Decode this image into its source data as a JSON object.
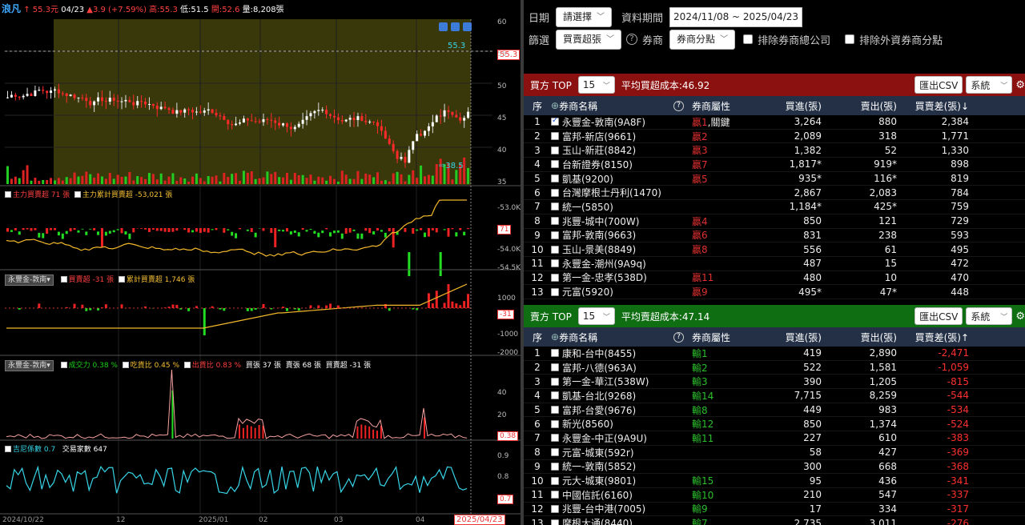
{
  "chart_header": {
    "name": "浪凡",
    "arrow": "↑",
    "price": "55.3元",
    "date": "04/23",
    "change": "▲3.9 (+7.59%)",
    "high": "高:55.3",
    "low": "低:51.5",
    "open": "開:52.6",
    "volume": "量:8,208張"
  },
  "price_axis": [
    "60",
    "55",
    "50",
    "45",
    "40",
    "35"
  ],
  "price_tags": {
    "last": "55.3",
    "high_mark": "55.3",
    "low_mark": "38.5"
  },
  "pane2": {
    "item1": "主力買賣超 71 張",
    "item2": "主力累計買賣超 -53,021 張",
    "axis": [
      "-53.0K",
      "-54.0K",
      "-54.5K"
    ],
    "tag": "71"
  },
  "pane3": {
    "select": "永豐金-敦南",
    "item1": "買賣超 -31 張",
    "item2": "累計買賣超 1,746 張",
    "axis": [
      "1000",
      "-1000",
      "-2000"
    ],
    "tag": "-31"
  },
  "pane4": {
    "select": "永豐金-敦南",
    "item1": "成交力 0.38 %",
    "item2": "吃貨比 0.45 %",
    "item3": "出貨比 0.83 %",
    "buy": "買張 37 張",
    "sell": "賣張 68 張",
    "net": "買賣超 -31 張",
    "axis": [
      "40",
      "20",
      "0"
    ],
    "tag": "0.38"
  },
  "pane5": {
    "item1": "吉尼係數 0.7",
    "item2": "交易家數 647",
    "axis": [
      "0.9",
      "0.8",
      "0.7"
    ],
    "tag": "0.7"
  },
  "x_axis": [
    "2024/10/22",
    "12",
    "2025/01",
    "02",
    "03",
    "04"
  ],
  "x_cursor": "2025/04/23",
  "filters": {
    "date_label": "日期",
    "date_select": "請選擇",
    "period_label": "資料期間",
    "period_value": "2024/11/08 ~ 2025/04/23",
    "filter_label": "篩選",
    "filter_select": "買賣超張",
    "broker_label": "券商",
    "broker_select": "券商分點",
    "excl1": "排除券商總公司",
    "excl2": "排除外資券商分點"
  },
  "buy_panel": {
    "title": "買方 TOP",
    "count": "15",
    "avg": "平均買超成本:46.92",
    "export": "匯出CSV",
    "system": "系統",
    "color": "#8b1010",
    "columns": [
      "序",
      "券商名稱",
      "券商屬性",
      "買進(張)",
      "賣出(張)",
      "買賣差(張)↓"
    ],
    "rows": [
      {
        "no": "1",
        "name": "永豐金-敦南(9A8F)",
        "attr": "贏1",
        "attr2": ",關鍵",
        "buy": "3,264",
        "sell": "880",
        "diff": "2,384",
        "checked": true
      },
      {
        "no": "2",
        "name": "富邦-新店(9661)",
        "attr": "贏2",
        "attr2": "",
        "buy": "2,089",
        "sell": "318",
        "diff": "1,771"
      },
      {
        "no": "3",
        "name": "玉山-新莊(8842)",
        "attr": "贏3",
        "attr2": "",
        "buy": "1,382",
        "sell": "52",
        "diff": "1,330"
      },
      {
        "no": "4",
        "name": "台新證券(8150)",
        "attr": "贏7",
        "attr2": "",
        "buy": "1,817*",
        "sell": "919*",
        "diff": "898"
      },
      {
        "no": "5",
        "name": "凱基(9200)",
        "attr": "贏5",
        "attr2": "",
        "buy": "935*",
        "sell": "116*",
        "diff": "819"
      },
      {
        "no": "6",
        "name": "台灣摩根士丹利(1470)",
        "attr": "",
        "attr2": "",
        "buy": "2,867",
        "sell": "2,083",
        "diff": "784"
      },
      {
        "no": "7",
        "name": "統一(5850)",
        "attr": "",
        "attr2": "",
        "buy": "1,184*",
        "sell": "425*",
        "diff": "759"
      },
      {
        "no": "8",
        "name": "兆豐-城中(700W)",
        "attr": "贏4",
        "attr2": "",
        "buy": "850",
        "sell": "121",
        "diff": "729"
      },
      {
        "no": "9",
        "name": "富邦-敦南(9663)",
        "attr": "贏6",
        "attr2": "",
        "buy": "831",
        "sell": "238",
        "diff": "593"
      },
      {
        "no": "10",
        "name": "玉山-景美(8849)",
        "attr": "贏8",
        "attr2": "",
        "buy": "556",
        "sell": "61",
        "diff": "495"
      },
      {
        "no": "11",
        "name": "永豐金-潮州(9A9q)",
        "attr": "",
        "attr2": "",
        "buy": "487",
        "sell": "15",
        "diff": "472"
      },
      {
        "no": "12",
        "name": "第一金-忠孝(538D)",
        "attr": "贏11",
        "attr2": "",
        "buy": "480",
        "sell": "10",
        "diff": "470"
      },
      {
        "no": "13",
        "name": "元富(5920)",
        "attr": "贏9",
        "attr2": "",
        "buy": "495*",
        "sell": "47*",
        "diff": "448"
      }
    ]
  },
  "sell_panel": {
    "title": "賣方 TOP",
    "count": "15",
    "avg": "平均賣超成本:47.14",
    "export": "匯出CSV",
    "system": "系統",
    "color": "#0f6d12",
    "columns": [
      "序",
      "券商名稱",
      "券商屬性",
      "買進(張)",
      "賣出(張)",
      "買賣差(張)↑"
    ],
    "rows": [
      {
        "no": "1",
        "name": "康和-台中(8455)",
        "attr": "輸1",
        "buy": "419",
        "sell": "2,890",
        "diff": "-2,471"
      },
      {
        "no": "2",
        "name": "富邦-八德(963A)",
        "attr": "輸2",
        "buy": "522",
        "sell": "1,581",
        "diff": "-1,059"
      },
      {
        "no": "3",
        "name": "第一金-華江(538W)",
        "attr": "輸3",
        "buy": "390",
        "sell": "1,205",
        "diff": "-815"
      },
      {
        "no": "4",
        "name": "凱基-台北(9268)",
        "attr": "輸14",
        "buy": "7,715",
        "sell": "8,259",
        "diff": "-544"
      },
      {
        "no": "5",
        "name": "富邦-台愛(9676)",
        "attr": "輸8",
        "buy": "449",
        "sell": "983",
        "diff": "-534"
      },
      {
        "no": "6",
        "name": "新光(8560)",
        "attr": "輸12",
        "buy": "850",
        "sell": "1,374",
        "diff": "-524"
      },
      {
        "no": "7",
        "name": "永豐金-中正(9A9U)",
        "attr": "輸11",
        "buy": "227",
        "sell": "610",
        "diff": "-383"
      },
      {
        "no": "8",
        "name": "元富-城東(592r)",
        "attr": "",
        "buy": "58",
        "sell": "427",
        "diff": "-369"
      },
      {
        "no": "9",
        "name": "統一-敦南(5852)",
        "attr": "",
        "buy": "300",
        "sell": "668",
        "diff": "-368"
      },
      {
        "no": "10",
        "name": "元大-城東(9801)",
        "attr": "輸15",
        "buy": "95",
        "sell": "436",
        "diff": "-341"
      },
      {
        "no": "11",
        "name": "中國信託(6160)",
        "attr": "輸10",
        "buy": "210",
        "sell": "547",
        "diff": "-337"
      },
      {
        "no": "12",
        "name": "兆豐-台中港(7005)",
        "attr": "輸9",
        "buy": "17",
        "sell": "334",
        "diff": "-317"
      },
      {
        "no": "13",
        "name": "摩根大通(8440)",
        "attr": "輸7",
        "buy": "2,735",
        "sell": "3,011",
        "diff": "-276"
      }
    ]
  }
}
